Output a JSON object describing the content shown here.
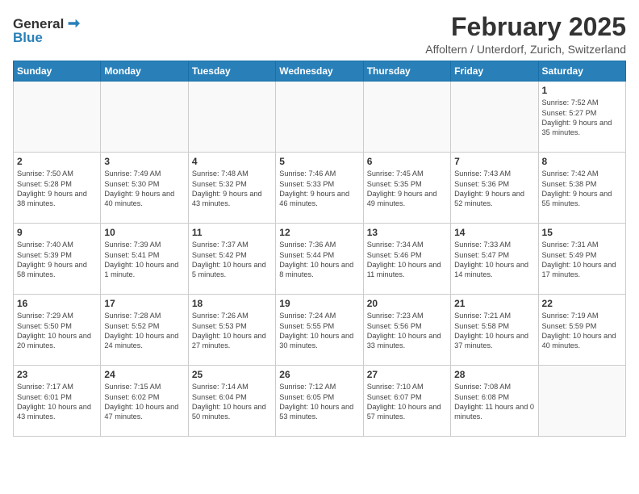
{
  "header": {
    "logo_general": "General",
    "logo_blue": "Blue",
    "month": "February 2025",
    "location": "Affoltern / Unterdorf, Zurich, Switzerland"
  },
  "weekdays": [
    "Sunday",
    "Monday",
    "Tuesday",
    "Wednesday",
    "Thursday",
    "Friday",
    "Saturday"
  ],
  "weeks": [
    [
      {
        "day": "",
        "info": ""
      },
      {
        "day": "",
        "info": ""
      },
      {
        "day": "",
        "info": ""
      },
      {
        "day": "",
        "info": ""
      },
      {
        "day": "",
        "info": ""
      },
      {
        "day": "",
        "info": ""
      },
      {
        "day": "1",
        "info": "Sunrise: 7:52 AM\nSunset: 5:27 PM\nDaylight: 9 hours and 35 minutes."
      }
    ],
    [
      {
        "day": "2",
        "info": "Sunrise: 7:50 AM\nSunset: 5:28 PM\nDaylight: 9 hours and 38 minutes."
      },
      {
        "day": "3",
        "info": "Sunrise: 7:49 AM\nSunset: 5:30 PM\nDaylight: 9 hours and 40 minutes."
      },
      {
        "day": "4",
        "info": "Sunrise: 7:48 AM\nSunset: 5:32 PM\nDaylight: 9 hours and 43 minutes."
      },
      {
        "day": "5",
        "info": "Sunrise: 7:46 AM\nSunset: 5:33 PM\nDaylight: 9 hours and 46 minutes."
      },
      {
        "day": "6",
        "info": "Sunrise: 7:45 AM\nSunset: 5:35 PM\nDaylight: 9 hours and 49 minutes."
      },
      {
        "day": "7",
        "info": "Sunrise: 7:43 AM\nSunset: 5:36 PM\nDaylight: 9 hours and 52 minutes."
      },
      {
        "day": "8",
        "info": "Sunrise: 7:42 AM\nSunset: 5:38 PM\nDaylight: 9 hours and 55 minutes."
      }
    ],
    [
      {
        "day": "9",
        "info": "Sunrise: 7:40 AM\nSunset: 5:39 PM\nDaylight: 9 hours and 58 minutes."
      },
      {
        "day": "10",
        "info": "Sunrise: 7:39 AM\nSunset: 5:41 PM\nDaylight: 10 hours and 1 minute."
      },
      {
        "day": "11",
        "info": "Sunrise: 7:37 AM\nSunset: 5:42 PM\nDaylight: 10 hours and 5 minutes."
      },
      {
        "day": "12",
        "info": "Sunrise: 7:36 AM\nSunset: 5:44 PM\nDaylight: 10 hours and 8 minutes."
      },
      {
        "day": "13",
        "info": "Sunrise: 7:34 AM\nSunset: 5:46 PM\nDaylight: 10 hours and 11 minutes."
      },
      {
        "day": "14",
        "info": "Sunrise: 7:33 AM\nSunset: 5:47 PM\nDaylight: 10 hours and 14 minutes."
      },
      {
        "day": "15",
        "info": "Sunrise: 7:31 AM\nSunset: 5:49 PM\nDaylight: 10 hours and 17 minutes."
      }
    ],
    [
      {
        "day": "16",
        "info": "Sunrise: 7:29 AM\nSunset: 5:50 PM\nDaylight: 10 hours and 20 minutes."
      },
      {
        "day": "17",
        "info": "Sunrise: 7:28 AM\nSunset: 5:52 PM\nDaylight: 10 hours and 24 minutes."
      },
      {
        "day": "18",
        "info": "Sunrise: 7:26 AM\nSunset: 5:53 PM\nDaylight: 10 hours and 27 minutes."
      },
      {
        "day": "19",
        "info": "Sunrise: 7:24 AM\nSunset: 5:55 PM\nDaylight: 10 hours and 30 minutes."
      },
      {
        "day": "20",
        "info": "Sunrise: 7:23 AM\nSunset: 5:56 PM\nDaylight: 10 hours and 33 minutes."
      },
      {
        "day": "21",
        "info": "Sunrise: 7:21 AM\nSunset: 5:58 PM\nDaylight: 10 hours and 37 minutes."
      },
      {
        "day": "22",
        "info": "Sunrise: 7:19 AM\nSunset: 5:59 PM\nDaylight: 10 hours and 40 minutes."
      }
    ],
    [
      {
        "day": "23",
        "info": "Sunrise: 7:17 AM\nSunset: 6:01 PM\nDaylight: 10 hours and 43 minutes."
      },
      {
        "day": "24",
        "info": "Sunrise: 7:15 AM\nSunset: 6:02 PM\nDaylight: 10 hours and 47 minutes."
      },
      {
        "day": "25",
        "info": "Sunrise: 7:14 AM\nSunset: 6:04 PM\nDaylight: 10 hours and 50 minutes."
      },
      {
        "day": "26",
        "info": "Sunrise: 7:12 AM\nSunset: 6:05 PM\nDaylight: 10 hours and 53 minutes."
      },
      {
        "day": "27",
        "info": "Sunrise: 7:10 AM\nSunset: 6:07 PM\nDaylight: 10 hours and 57 minutes."
      },
      {
        "day": "28",
        "info": "Sunrise: 7:08 AM\nSunset: 6:08 PM\nDaylight: 11 hours and 0 minutes."
      },
      {
        "day": "",
        "info": ""
      }
    ]
  ]
}
